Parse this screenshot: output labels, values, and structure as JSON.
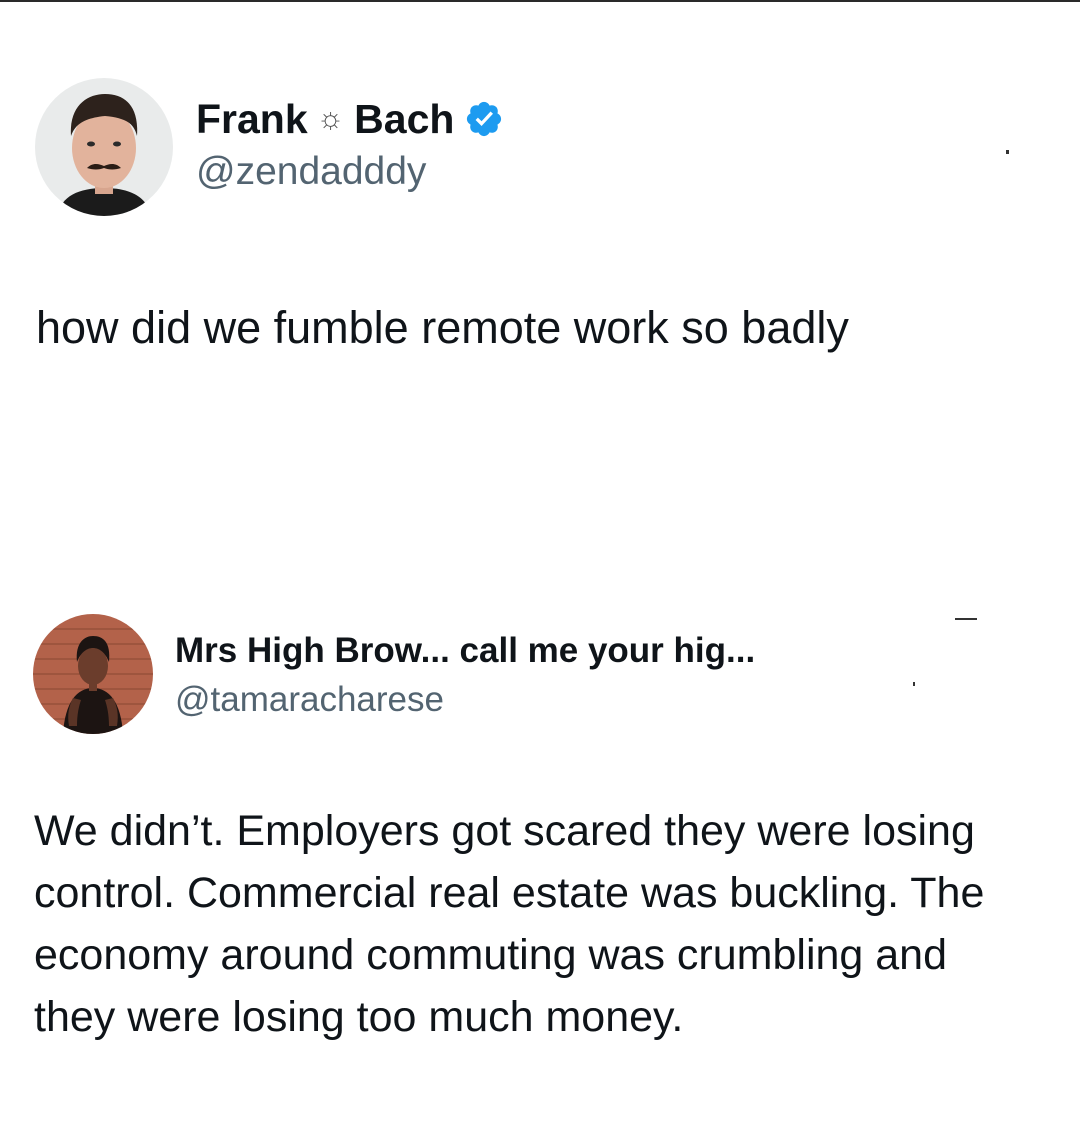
{
  "tweet": {
    "author": {
      "name_first": "Frank",
      "name_separator": "☼",
      "name_last": "Bach",
      "handle": "@zendadddy",
      "verified": true,
      "avatar_icon": "profile-photo-man-mustache"
    },
    "text": "how did we fumble remote work so badly"
  },
  "reply": {
    "author": {
      "name": "Mrs High Brow... call me your hig...",
      "handle": "@tamaracharese",
      "avatar_icon": "profile-photo-woman-brick-wall"
    },
    "text_lines": [
      "We didn’t. Employers got scared they were losing",
      "control. Commercial real estate was buckling. The",
      "economy around commuting was crumbling and",
      "they were losing too much money."
    ]
  },
  "colors": {
    "text": "#0f1419",
    "secondary_text": "#536471",
    "verified_badge": "#1d9bf0",
    "background": "#ffffff"
  }
}
